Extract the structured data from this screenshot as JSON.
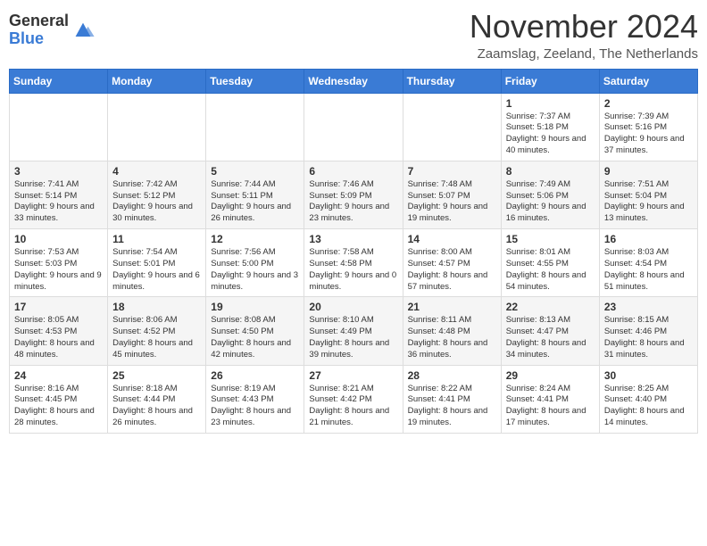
{
  "logo": {
    "general": "General",
    "blue": "Blue"
  },
  "title": "November 2024",
  "subtitle": "Zaamslag, Zeeland, The Netherlands",
  "days_of_week": [
    "Sunday",
    "Monday",
    "Tuesday",
    "Wednesday",
    "Thursday",
    "Friday",
    "Saturday"
  ],
  "weeks": [
    [
      {
        "day": "",
        "info": ""
      },
      {
        "day": "",
        "info": ""
      },
      {
        "day": "",
        "info": ""
      },
      {
        "day": "",
        "info": ""
      },
      {
        "day": "",
        "info": ""
      },
      {
        "day": "1",
        "info": "Sunrise: 7:37 AM\nSunset: 5:18 PM\nDaylight: 9 hours and 40 minutes."
      },
      {
        "day": "2",
        "info": "Sunrise: 7:39 AM\nSunset: 5:16 PM\nDaylight: 9 hours and 37 minutes."
      }
    ],
    [
      {
        "day": "3",
        "info": "Sunrise: 7:41 AM\nSunset: 5:14 PM\nDaylight: 9 hours and 33 minutes."
      },
      {
        "day": "4",
        "info": "Sunrise: 7:42 AM\nSunset: 5:12 PM\nDaylight: 9 hours and 30 minutes."
      },
      {
        "day": "5",
        "info": "Sunrise: 7:44 AM\nSunset: 5:11 PM\nDaylight: 9 hours and 26 minutes."
      },
      {
        "day": "6",
        "info": "Sunrise: 7:46 AM\nSunset: 5:09 PM\nDaylight: 9 hours and 23 minutes."
      },
      {
        "day": "7",
        "info": "Sunrise: 7:48 AM\nSunset: 5:07 PM\nDaylight: 9 hours and 19 minutes."
      },
      {
        "day": "8",
        "info": "Sunrise: 7:49 AM\nSunset: 5:06 PM\nDaylight: 9 hours and 16 minutes."
      },
      {
        "day": "9",
        "info": "Sunrise: 7:51 AM\nSunset: 5:04 PM\nDaylight: 9 hours and 13 minutes."
      }
    ],
    [
      {
        "day": "10",
        "info": "Sunrise: 7:53 AM\nSunset: 5:03 PM\nDaylight: 9 hours and 9 minutes."
      },
      {
        "day": "11",
        "info": "Sunrise: 7:54 AM\nSunset: 5:01 PM\nDaylight: 9 hours and 6 minutes."
      },
      {
        "day": "12",
        "info": "Sunrise: 7:56 AM\nSunset: 5:00 PM\nDaylight: 9 hours and 3 minutes."
      },
      {
        "day": "13",
        "info": "Sunrise: 7:58 AM\nSunset: 4:58 PM\nDaylight: 9 hours and 0 minutes."
      },
      {
        "day": "14",
        "info": "Sunrise: 8:00 AM\nSunset: 4:57 PM\nDaylight: 8 hours and 57 minutes."
      },
      {
        "day": "15",
        "info": "Sunrise: 8:01 AM\nSunset: 4:55 PM\nDaylight: 8 hours and 54 minutes."
      },
      {
        "day": "16",
        "info": "Sunrise: 8:03 AM\nSunset: 4:54 PM\nDaylight: 8 hours and 51 minutes."
      }
    ],
    [
      {
        "day": "17",
        "info": "Sunrise: 8:05 AM\nSunset: 4:53 PM\nDaylight: 8 hours and 48 minutes."
      },
      {
        "day": "18",
        "info": "Sunrise: 8:06 AM\nSunset: 4:52 PM\nDaylight: 8 hours and 45 minutes."
      },
      {
        "day": "19",
        "info": "Sunrise: 8:08 AM\nSunset: 4:50 PM\nDaylight: 8 hours and 42 minutes."
      },
      {
        "day": "20",
        "info": "Sunrise: 8:10 AM\nSunset: 4:49 PM\nDaylight: 8 hours and 39 minutes."
      },
      {
        "day": "21",
        "info": "Sunrise: 8:11 AM\nSunset: 4:48 PM\nDaylight: 8 hours and 36 minutes."
      },
      {
        "day": "22",
        "info": "Sunrise: 8:13 AM\nSunset: 4:47 PM\nDaylight: 8 hours and 34 minutes."
      },
      {
        "day": "23",
        "info": "Sunrise: 8:15 AM\nSunset: 4:46 PM\nDaylight: 8 hours and 31 minutes."
      }
    ],
    [
      {
        "day": "24",
        "info": "Sunrise: 8:16 AM\nSunset: 4:45 PM\nDaylight: 8 hours and 28 minutes."
      },
      {
        "day": "25",
        "info": "Sunrise: 8:18 AM\nSunset: 4:44 PM\nDaylight: 8 hours and 26 minutes."
      },
      {
        "day": "26",
        "info": "Sunrise: 8:19 AM\nSunset: 4:43 PM\nDaylight: 8 hours and 23 minutes."
      },
      {
        "day": "27",
        "info": "Sunrise: 8:21 AM\nSunset: 4:42 PM\nDaylight: 8 hours and 21 minutes."
      },
      {
        "day": "28",
        "info": "Sunrise: 8:22 AM\nSunset: 4:41 PM\nDaylight: 8 hours and 19 minutes."
      },
      {
        "day": "29",
        "info": "Sunrise: 8:24 AM\nSunset: 4:41 PM\nDaylight: 8 hours and 17 minutes."
      },
      {
        "day": "30",
        "info": "Sunrise: 8:25 AM\nSunset: 4:40 PM\nDaylight: 8 hours and 14 minutes."
      }
    ]
  ]
}
